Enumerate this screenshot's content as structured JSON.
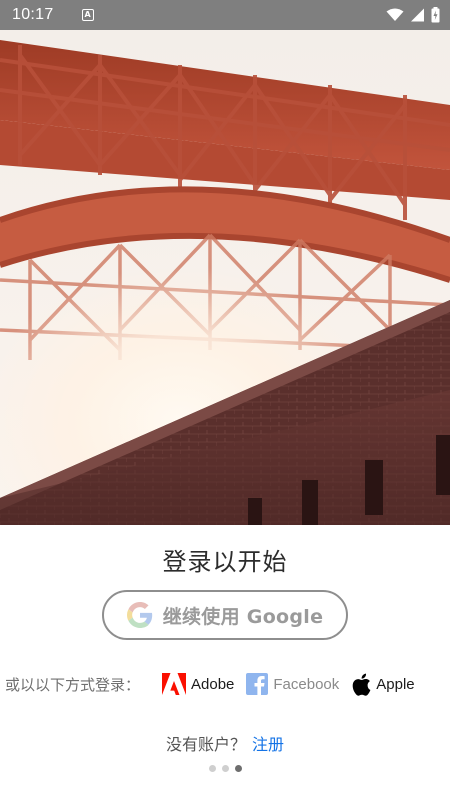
{
  "status_bar": {
    "time": "10:17",
    "notification_glyph": "A",
    "icons": [
      "wifi-icon",
      "cellular-signal-icon",
      "battery-charging-icon"
    ]
  },
  "hero": {
    "image": "golden-gate-bridge-underside-and-brick-fort-photo"
  },
  "login": {
    "title": "登录以开始",
    "google_button": {
      "label": "继续使用 Google",
      "icon": "google-icon"
    },
    "alt_label": "或以以下方式登录：",
    "providers": [
      {
        "label": "Adobe",
        "icon": "adobe-icon",
        "color": "#fa0f00"
      },
      {
        "label": "Facebook",
        "icon": "facebook-icon",
        "color": "#8fb5ee"
      },
      {
        "label": "Apple",
        "icon": "apple-icon",
        "color": "#000000"
      }
    ],
    "no_account": "没有账户？",
    "signup": "注册"
  },
  "pager": {
    "count": 3,
    "active": 3
  },
  "colors": {
    "status_bar": "#7f7f7f",
    "link": "#1473e6",
    "adobe_red": "#fa0f00",
    "facebook_blue": "#8fb5ee"
  }
}
